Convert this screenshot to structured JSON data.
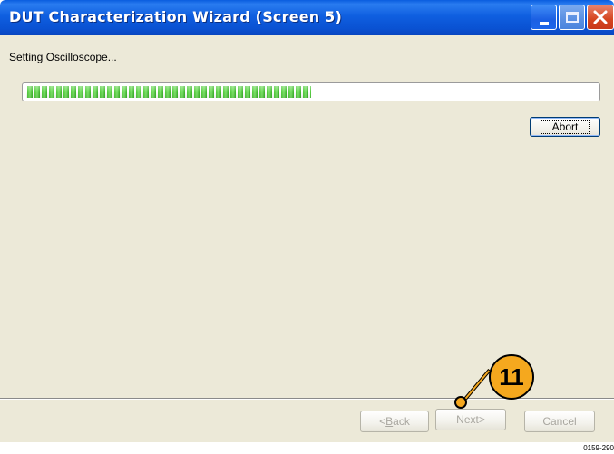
{
  "window": {
    "title": "DUT Characterization Wizard (Screen 5)",
    "controls": {
      "minimize": "minimize-icon",
      "maximize": "maximize-icon",
      "close": "close-icon"
    }
  },
  "status": {
    "text": "Setting Oscilloscope..."
  },
  "progress": {
    "value_percent": 50,
    "color": "#4fc83a"
  },
  "buttons": {
    "abort": "Abort",
    "back_prefix": "<",
    "back_key": "B",
    "back_rest": "ack",
    "next": "Next>",
    "cancel": "Cancel"
  },
  "callout": {
    "number": "11",
    "color": "#f5a81e"
  },
  "figure_code": "0159-290"
}
